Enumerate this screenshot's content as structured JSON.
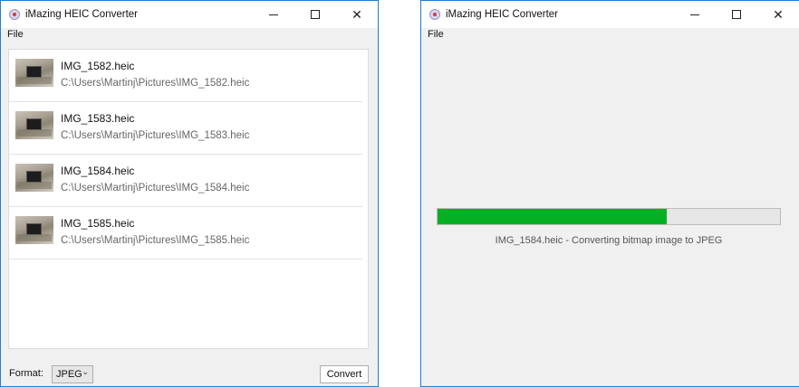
{
  "left_window": {
    "title": "iMazing HEIC Converter",
    "menu": {
      "file": "File"
    },
    "files": [
      {
        "name": "IMG_1582.heic",
        "path": "C:\\Users\\Martinj\\Pictures\\IMG_1582.heic"
      },
      {
        "name": "IMG_1583.heic",
        "path": "C:\\Users\\Martinj\\Pictures\\IMG_1583.heic"
      },
      {
        "name": "IMG_1584.heic",
        "path": "C:\\Users\\Martinj\\Pictures\\IMG_1584.heic"
      },
      {
        "name": "IMG_1585.heic",
        "path": "C:\\Users\\Martinj\\Pictures\\IMG_1585.heic"
      }
    ],
    "format_label": "Format:",
    "format_value": "JPEG",
    "convert_label": "Convert"
  },
  "right_window": {
    "title": "iMazing HEIC Converter",
    "menu": {
      "file": "File"
    },
    "progress_fraction": 0.67,
    "status": "IMG_1584.heic - Converting bitmap image to JPEG"
  },
  "icons": {
    "app": "imazing-app-icon",
    "minimize": "minimize-icon",
    "maximize": "maximize-icon",
    "close": "close-icon",
    "dropdown": "chevron-down-icon",
    "thumbnail": "photo-thumbnail"
  },
  "colors": {
    "window_border": "#1c7fd6",
    "progress_fill": "#06b025"
  }
}
